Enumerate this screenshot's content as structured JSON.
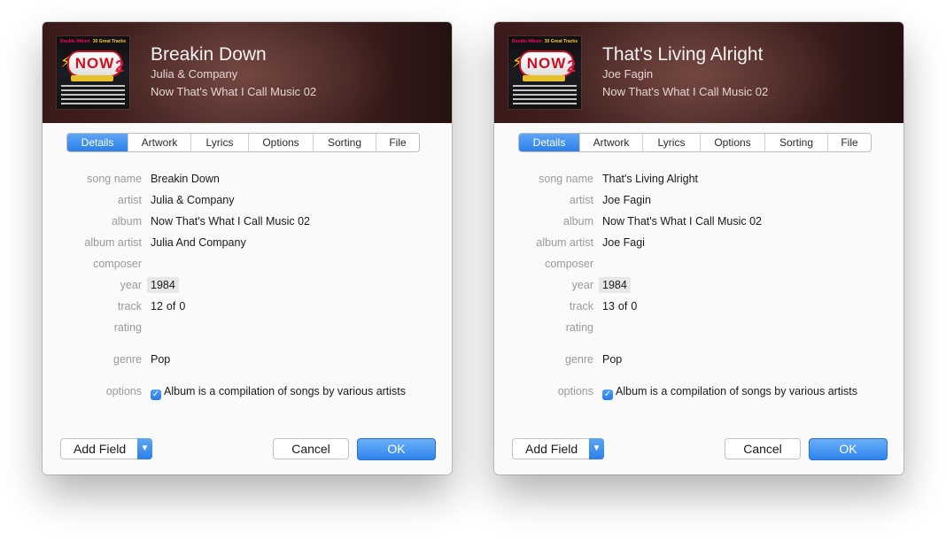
{
  "tabs": [
    "Details",
    "Artwork",
    "Lyrics",
    "Options",
    "Sorting",
    "File"
  ],
  "labels": {
    "song_name": "song name",
    "artist": "artist",
    "album": "album",
    "album_artist": "album artist",
    "composer": "composer",
    "year": "year",
    "track": "track",
    "rating": "rating",
    "genre": "genre",
    "options": "options"
  },
  "artwork": {
    "top_left": "Double Album",
    "top_right": "30 Great Tracks",
    "logo": "NOW",
    "number": "2"
  },
  "buttons": {
    "add_field": "Add Field",
    "cancel": "Cancel",
    "ok": "OK"
  },
  "dialogs": [
    {
      "title": "Breakin Down",
      "artist": "Julia & Company",
      "album": "Now That's What I Call Music 02",
      "fields": {
        "song_name": "Breakin Down",
        "artist": "Julia & Company",
        "album": "Now That's What I Call Music 02",
        "album_artist": "Julia And Company",
        "composer": "",
        "year": "1984",
        "track": "12",
        "track_of": "of",
        "track_total": "0",
        "rating": "",
        "genre": "Pop",
        "compilation_checked": true,
        "compilation_text": "Album is a compilation of songs by various artists"
      }
    },
    {
      "title": "That's Living Alright",
      "artist": "Joe Fagin",
      "album": "Now That's What I Call Music 02",
      "fields": {
        "song_name": "That's Living Alright",
        "artist": "Joe Fagin",
        "album": "Now That's What I Call Music 02",
        "album_artist": "Joe Fagi",
        "composer": "",
        "year": "1984",
        "track": "13",
        "track_of": "of",
        "track_total": "0",
        "rating": "",
        "genre": "Pop",
        "compilation_checked": true,
        "compilation_text": "Album is a compilation of songs by various artists"
      }
    }
  ]
}
